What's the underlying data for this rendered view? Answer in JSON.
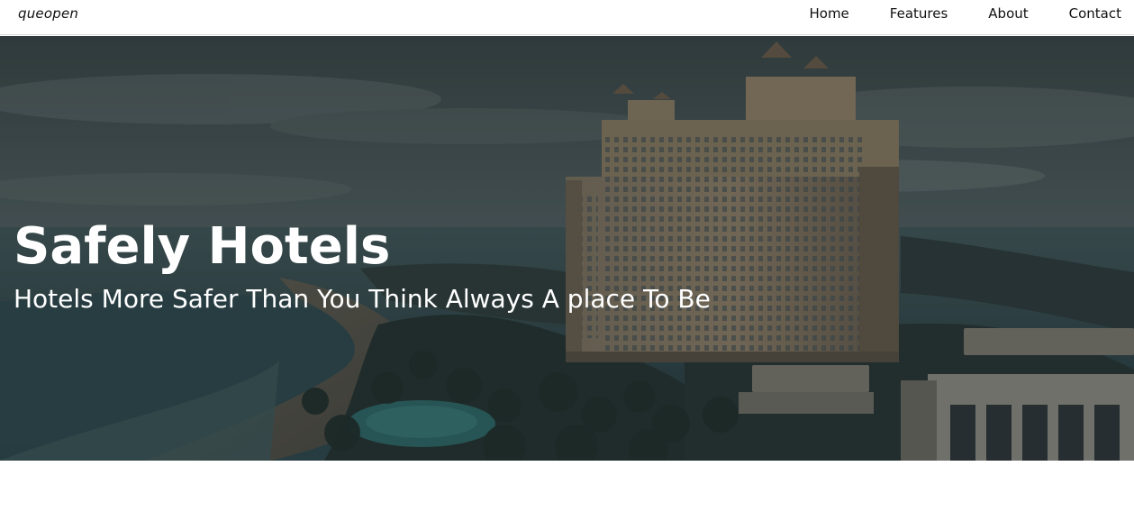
{
  "navbar": {
    "brand": "queopen",
    "links": [
      "Home",
      "Features",
      "About",
      "Contact"
    ]
  },
  "hero": {
    "title": "Safely Hotels",
    "subtitle": "Hotels More Safer Than You Think Always A place To Be"
  },
  "colors": {
    "nav_background": "#ffffff",
    "nav_text": "#111111",
    "hero_overlay": "#1f2a2e",
    "hero_text": "#ffffff"
  }
}
